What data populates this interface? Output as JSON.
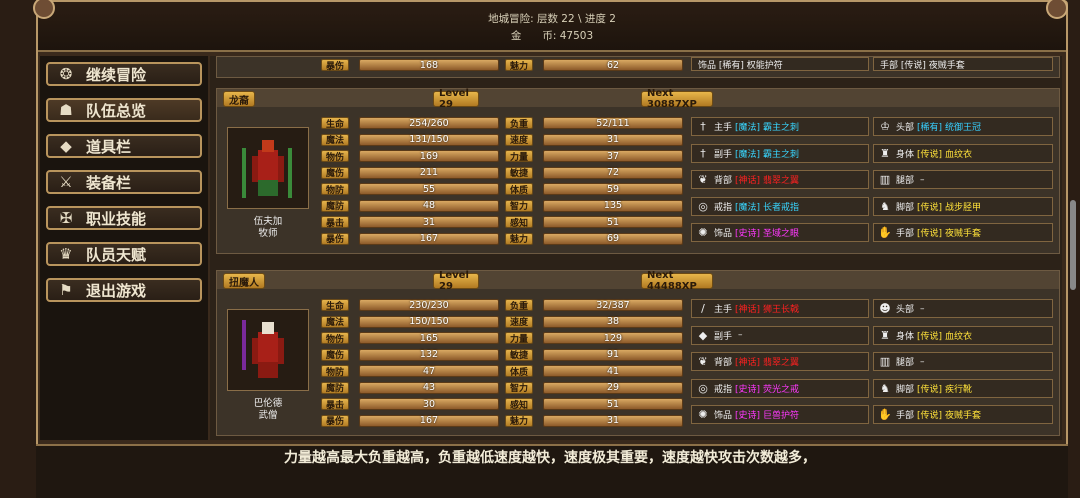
{
  "header": {
    "line1": "地城冒险: 层数 22 \\ 进度 2",
    "line2": "金　　币: 47503"
  },
  "menu": [
    {
      "label": "继续冒险",
      "icon": "dragon-icon"
    },
    {
      "label": "队伍总览",
      "icon": "party-icon"
    },
    {
      "label": "道具栏",
      "icon": "bag-icon"
    },
    {
      "label": "装备栏",
      "icon": "equipment-icon"
    },
    {
      "label": "职业技能",
      "icon": "skill-icon"
    },
    {
      "label": "队员天赋",
      "icon": "talent-icon"
    },
    {
      "label": "退出游戏",
      "icon": "exit-flag-icon"
    }
  ],
  "top_partial": {
    "l1": "暴伤",
    "v1": "168",
    "l2": "魅力",
    "v2": "62",
    "e1": "饰品 [稀有] 权能护符",
    "e2": "手部 [传说] 夜贼手套"
  },
  "heroes": [
    {
      "race": "龙裔",
      "level": "Level 29",
      "next": "Next 30887XP",
      "name": "伍夫加",
      "class": "牧师",
      "left_stats": [
        [
          "生命",
          "254/260"
        ],
        [
          "魔法",
          "131/150"
        ],
        [
          "物伤",
          "169"
        ],
        [
          "魔伤",
          "211"
        ],
        [
          "物防",
          "55"
        ],
        [
          "魔防",
          "48"
        ],
        [
          "暴击",
          "31"
        ],
        [
          "暴伤",
          "167"
        ]
      ],
      "right_stats": [
        [
          "负重",
          "52/111"
        ],
        [
          "速度",
          "31"
        ],
        [
          "力量",
          "37"
        ],
        [
          "敏捷",
          "72"
        ],
        [
          "体质",
          "59"
        ],
        [
          "智力",
          "135"
        ],
        [
          "感知",
          "51"
        ],
        [
          "魅力",
          "69"
        ]
      ],
      "equip_left": [
        {
          "slot": "主手",
          "rarity": "[魔法]",
          "rc": "r-magic",
          "item": "霸主之刺",
          "ic": "r-magic",
          "icon": "dagger-icon"
        },
        {
          "slot": "副手",
          "rarity": "[魔法]",
          "rc": "r-magic",
          "item": "霸主之刺",
          "ic": "r-magic",
          "icon": "dagger-icon"
        },
        {
          "slot": "背部",
          "rarity": "[神话]",
          "rc": "r-red",
          "item": "翡翠之翼",
          "ic": "r-red",
          "icon": "wings-icon"
        },
        {
          "slot": "戒指",
          "rarity": "[魔法]",
          "rc": "r-magic",
          "item": "长者戒指",
          "ic": "r-magic",
          "icon": "ring-icon"
        },
        {
          "slot": "饰品",
          "rarity": "[史诗]",
          "rc": "r-epic",
          "item": "圣域之眼",
          "ic": "r-epic",
          "icon": "amulet-icon"
        }
      ],
      "equip_right": [
        {
          "slot": "头部",
          "rarity": "[稀有]",
          "rc": "r-rare",
          "item": "统御王冠",
          "ic": "r-rare",
          "icon": "crown-icon"
        },
        {
          "slot": "身体",
          "rarity": "[传说]",
          "rc": "r-leg",
          "item": "血纹衣",
          "ic": "r-leg",
          "icon": "robe-icon"
        },
        {
          "slot": "腿部",
          "rarity": "",
          "rc": "",
          "item": "–",
          "ic": "",
          "icon": "legs-icon"
        },
        {
          "slot": "脚部",
          "rarity": "[传说]",
          "rc": "r-leg",
          "item": "战步胫甲",
          "ic": "r-leg",
          "icon": "boots-icon"
        },
        {
          "slot": "手部",
          "rarity": "[传说]",
          "rc": "r-leg",
          "item": "夜贼手套",
          "ic": "r-leg",
          "icon": "gloves-icon"
        }
      ]
    },
    {
      "race": "扭魔人",
      "level": "Level 29",
      "next": "Next 44488XP",
      "name": "巴伦德",
      "class": "武僧",
      "left_stats": [
        [
          "生命",
          "230/230"
        ],
        [
          "魔法",
          "150/150"
        ],
        [
          "物伤",
          "165"
        ],
        [
          "魔伤",
          "132"
        ],
        [
          "物防",
          "47"
        ],
        [
          "魔防",
          "43"
        ],
        [
          "暴击",
          "30"
        ],
        [
          "暴伤",
          "167"
        ]
      ],
      "right_stats": [
        [
          "负重",
          "32/387"
        ],
        [
          "速度",
          "38"
        ],
        [
          "力量",
          "129"
        ],
        [
          "敏捷",
          "91"
        ],
        [
          "体质",
          "41"
        ],
        [
          "智力",
          "29"
        ],
        [
          "感知",
          "51"
        ],
        [
          "魅力",
          "31"
        ]
      ],
      "equip_left": [
        {
          "slot": "主手",
          "rarity": "[神话]",
          "rc": "r-red",
          "item": "狮王长戟",
          "ic": "r-red",
          "icon": "staff-icon"
        },
        {
          "slot": "副手",
          "rarity": "",
          "rc": "",
          "item": "–",
          "ic": "",
          "icon": "shield-icon"
        },
        {
          "slot": "背部",
          "rarity": "[神话]",
          "rc": "r-red",
          "item": "翡翠之翼",
          "ic": "r-red",
          "icon": "wings-icon"
        },
        {
          "slot": "戒指",
          "rarity": "[史诗]",
          "rc": "r-epic",
          "item": "荧光之戒",
          "ic": "r-epic",
          "icon": "ring-icon"
        },
        {
          "slot": "饰品",
          "rarity": "[史诗]",
          "rc": "r-epic",
          "item": "巨兽护符",
          "ic": "r-epic",
          "icon": "amulet-icon"
        }
      ],
      "equip_right": [
        {
          "slot": "头部",
          "rarity": "",
          "rc": "",
          "item": "–",
          "ic": "",
          "icon": "head-icon"
        },
        {
          "slot": "身体",
          "rarity": "[传说]",
          "rc": "r-leg",
          "item": "血纹衣",
          "ic": "r-leg",
          "icon": "robe-icon"
        },
        {
          "slot": "腿部",
          "rarity": "",
          "rc": "",
          "item": "–",
          "ic": "",
          "icon": "legs-icon"
        },
        {
          "slot": "脚部",
          "rarity": "[传说]",
          "rc": "r-leg",
          "item": "疾行靴",
          "ic": "r-leg",
          "icon": "boots-icon"
        },
        {
          "slot": "手部",
          "rarity": "[传说]",
          "rc": "r-leg",
          "item": "夜贼手套",
          "ic": "r-leg",
          "icon": "gloves-icon"
        }
      ]
    }
  ],
  "tip": "力量越高最大负重越高，负重越低速度越快，速度极其重要，速度越快攻击次数越多，"
}
